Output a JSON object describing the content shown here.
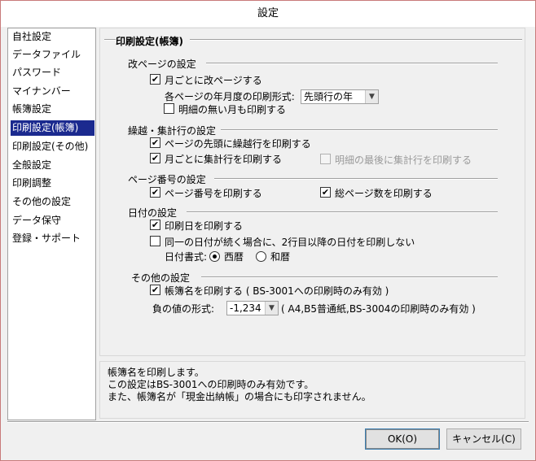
{
  "window": {
    "title": "設定"
  },
  "sidebar": {
    "items": [
      {
        "label": "自社設定",
        "selected": false
      },
      {
        "label": "データファイル",
        "selected": false
      },
      {
        "label": "パスワード",
        "selected": false
      },
      {
        "label": "マイナンバー",
        "selected": false
      },
      {
        "label": "帳簿設定",
        "selected": false
      },
      {
        "label": "印刷設定(帳簿)",
        "selected": true
      },
      {
        "label": "印刷設定(その他)",
        "selected": false
      },
      {
        "label": "全般設定",
        "selected": false
      },
      {
        "label": "印刷調整",
        "selected": false
      },
      {
        "label": "その他の設定",
        "selected": false
      },
      {
        "label": "データ保守",
        "selected": false
      },
      {
        "label": "登録・サポート",
        "selected": false
      }
    ]
  },
  "panel": {
    "title": "印刷設定(帳簿)",
    "page_break": {
      "heading": "改ページの設定",
      "monthly_break_label": "月ごとに改ページする",
      "monthly_break_checked": true,
      "year_format_label": "各ページの年月度の印刷形式:",
      "year_format_value": "先頭行の年",
      "print_empty_months_label": "明細の無い月も印刷する",
      "print_empty_months_checked": false
    },
    "carryover": {
      "heading": "繰越・集計行の設定",
      "carry_top_label": "ページの先頭に繰越行を印刷する",
      "carry_top_checked": true,
      "monthly_total_label": "月ごとに集計行を印刷する",
      "monthly_total_checked": true,
      "last_detail_total_label": "明細の最後に集計行を印刷する",
      "last_detail_total_checked": false
    },
    "page_number": {
      "heading": "ページ番号の設定",
      "print_page_no_label": "ページ番号を印刷する",
      "print_page_no_checked": true,
      "print_total_pages_label": "総ページ数を印刷する",
      "print_total_pages_checked": true
    },
    "date": {
      "heading": "日付の設定",
      "print_date_label": "印刷日を印刷する",
      "print_date_checked": true,
      "same_date_label": "同一の日付が続く場合に、2行目以降の日付を印刷しない",
      "same_date_checked": false,
      "date_format_label": "日付書式:",
      "western_label": "西暦",
      "japanese_label": "和暦",
      "selected_format": "western"
    },
    "other": {
      "heading": "その他の設定",
      "print_book_name_label": "帳簿名を印刷する ( BS-3001への印刷時のみ有効 )",
      "print_book_name_checked": true,
      "negative_format_label": "負の値の形式:",
      "negative_format_value": "-1,234",
      "negative_format_note": "( A4,B5普通紙,BS-3004の印刷時のみ有効 )"
    }
  },
  "description": {
    "lines": [
      "帳簿名を印刷します。",
      "この設定はBS-3001への印刷時のみ有効です。",
      "また、帳簿名が「現金出納帳」の場合にも印字されません。"
    ]
  },
  "buttons": {
    "ok_label": "OK(O)",
    "cancel_label": "キャンセル(C)"
  },
  "icons": {
    "checkmark": "check-icon",
    "dropdown": "chevron-down-icon"
  }
}
